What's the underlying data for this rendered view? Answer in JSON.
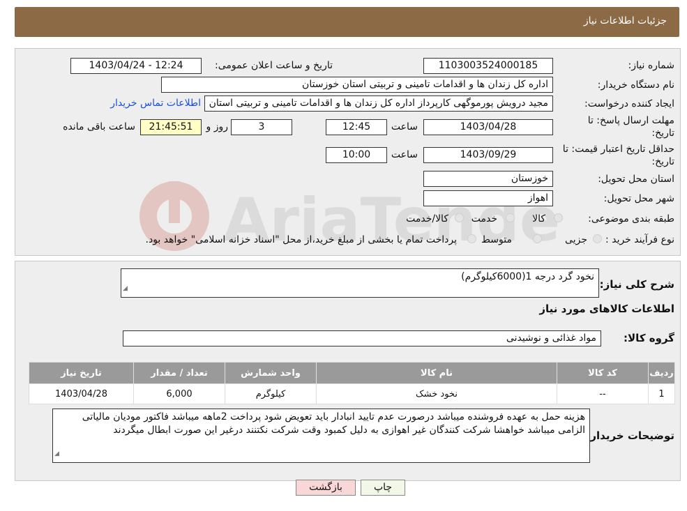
{
  "header": {
    "title": "جزئیات اطلاعات نیاز"
  },
  "details": {
    "need_number_label": "شماره نیاز:",
    "need_number": "1103003524000185",
    "announce_label": "تاریخ و ساعت اعلان عمومی:",
    "announce_value": "1403/04/24 - 12:24",
    "buyer_org_label": "نام دستگاه خریدار:",
    "buyer_org": "اداره کل زندان ها و اقدامات تامینی و تربیتی استان خوزستان",
    "creator_label": "ایجاد کننده درخواست:",
    "creator": "مجید درویش پورموگهی کارپرداز اداره کل زندان ها و اقدامات تامینی و تربیتی استان خوزستان",
    "contact_link": "اطلاعات تماس خریدار",
    "deadline_label_1": "مهلت ارسال پاسخ: تا",
    "deadline_label_2": "تاریخ:",
    "deadline_date": "1403/04/28",
    "time_word": "ساعت",
    "deadline_time": "12:45",
    "days_value": "3",
    "days_word": "روز و",
    "remaining_time": "21:45:51",
    "remaining_word": "ساعت باقی مانده",
    "validity_label_1": "حداقل تاریخ اعتبار قیمت: تا",
    "validity_label_2": "تاریخ:",
    "validity_date": "1403/09/29",
    "validity_time": "10:00",
    "province_label": "استان محل تحویل:",
    "province": "خوزستان",
    "city_label": "شهر محل تحویل:",
    "city": "اهواز",
    "category_label": "طبقه بندی موضوعی:",
    "category_options": [
      "کالا",
      "خدمت",
      "کالا/خدمت"
    ],
    "process_label": "نوع فرآیند خرید :",
    "process_options": [
      "جزیی",
      "متوسط"
    ],
    "process_note": "پرداخت تمام یا بخشی از مبلغ خرید،از محل \"اسناد خزانه اسلامی\" خواهد بود."
  },
  "need": {
    "summary_label": "شرح کلی نیاز:",
    "summary": "نخود گرد درجه 1(6000کیلوگرم)",
    "goods_info_title": "اطلاعات کالاهای مورد نیاز",
    "group_label": "گروه کالا:",
    "group": "مواد غذائی و نوشیدنی"
  },
  "table": {
    "headers": [
      "ردیف",
      "کد کالا",
      "نام کالا",
      "واحد شمارش",
      "تعداد / مقدار",
      "تاریخ نیاز"
    ],
    "rows": [
      [
        "1",
        "--",
        "نخود خشک",
        "کیلوگرم",
        "6,000",
        "1403/04/28"
      ]
    ]
  },
  "buyer_notes": {
    "label": "توضیحات خریدار:",
    "text": "هزینه حمل به عهده فروشنده میباشد درصورت عدم تایید انبادار باید تعویض شود پرداخت 2ماهه میباشد فاکتور مودیان مالیاتی الزامی میباشد خواهشا شرکت کنندگان غیر اهوازی به دلیل کمبود وقت شرکت نکتنند درغیر این صورت ابطال میگردند"
  },
  "buttons": {
    "print": "چاپ",
    "back": "بازگشت"
  },
  "watermark": {
    "text": "AriaTender.neT"
  },
  "colors": {
    "header": "#8B6A45",
    "remaining_bg": "#FFFFC6",
    "link": "#1a4fd8",
    "back_button": "#F8D7D7",
    "print_button": "#F2F8E8"
  }
}
